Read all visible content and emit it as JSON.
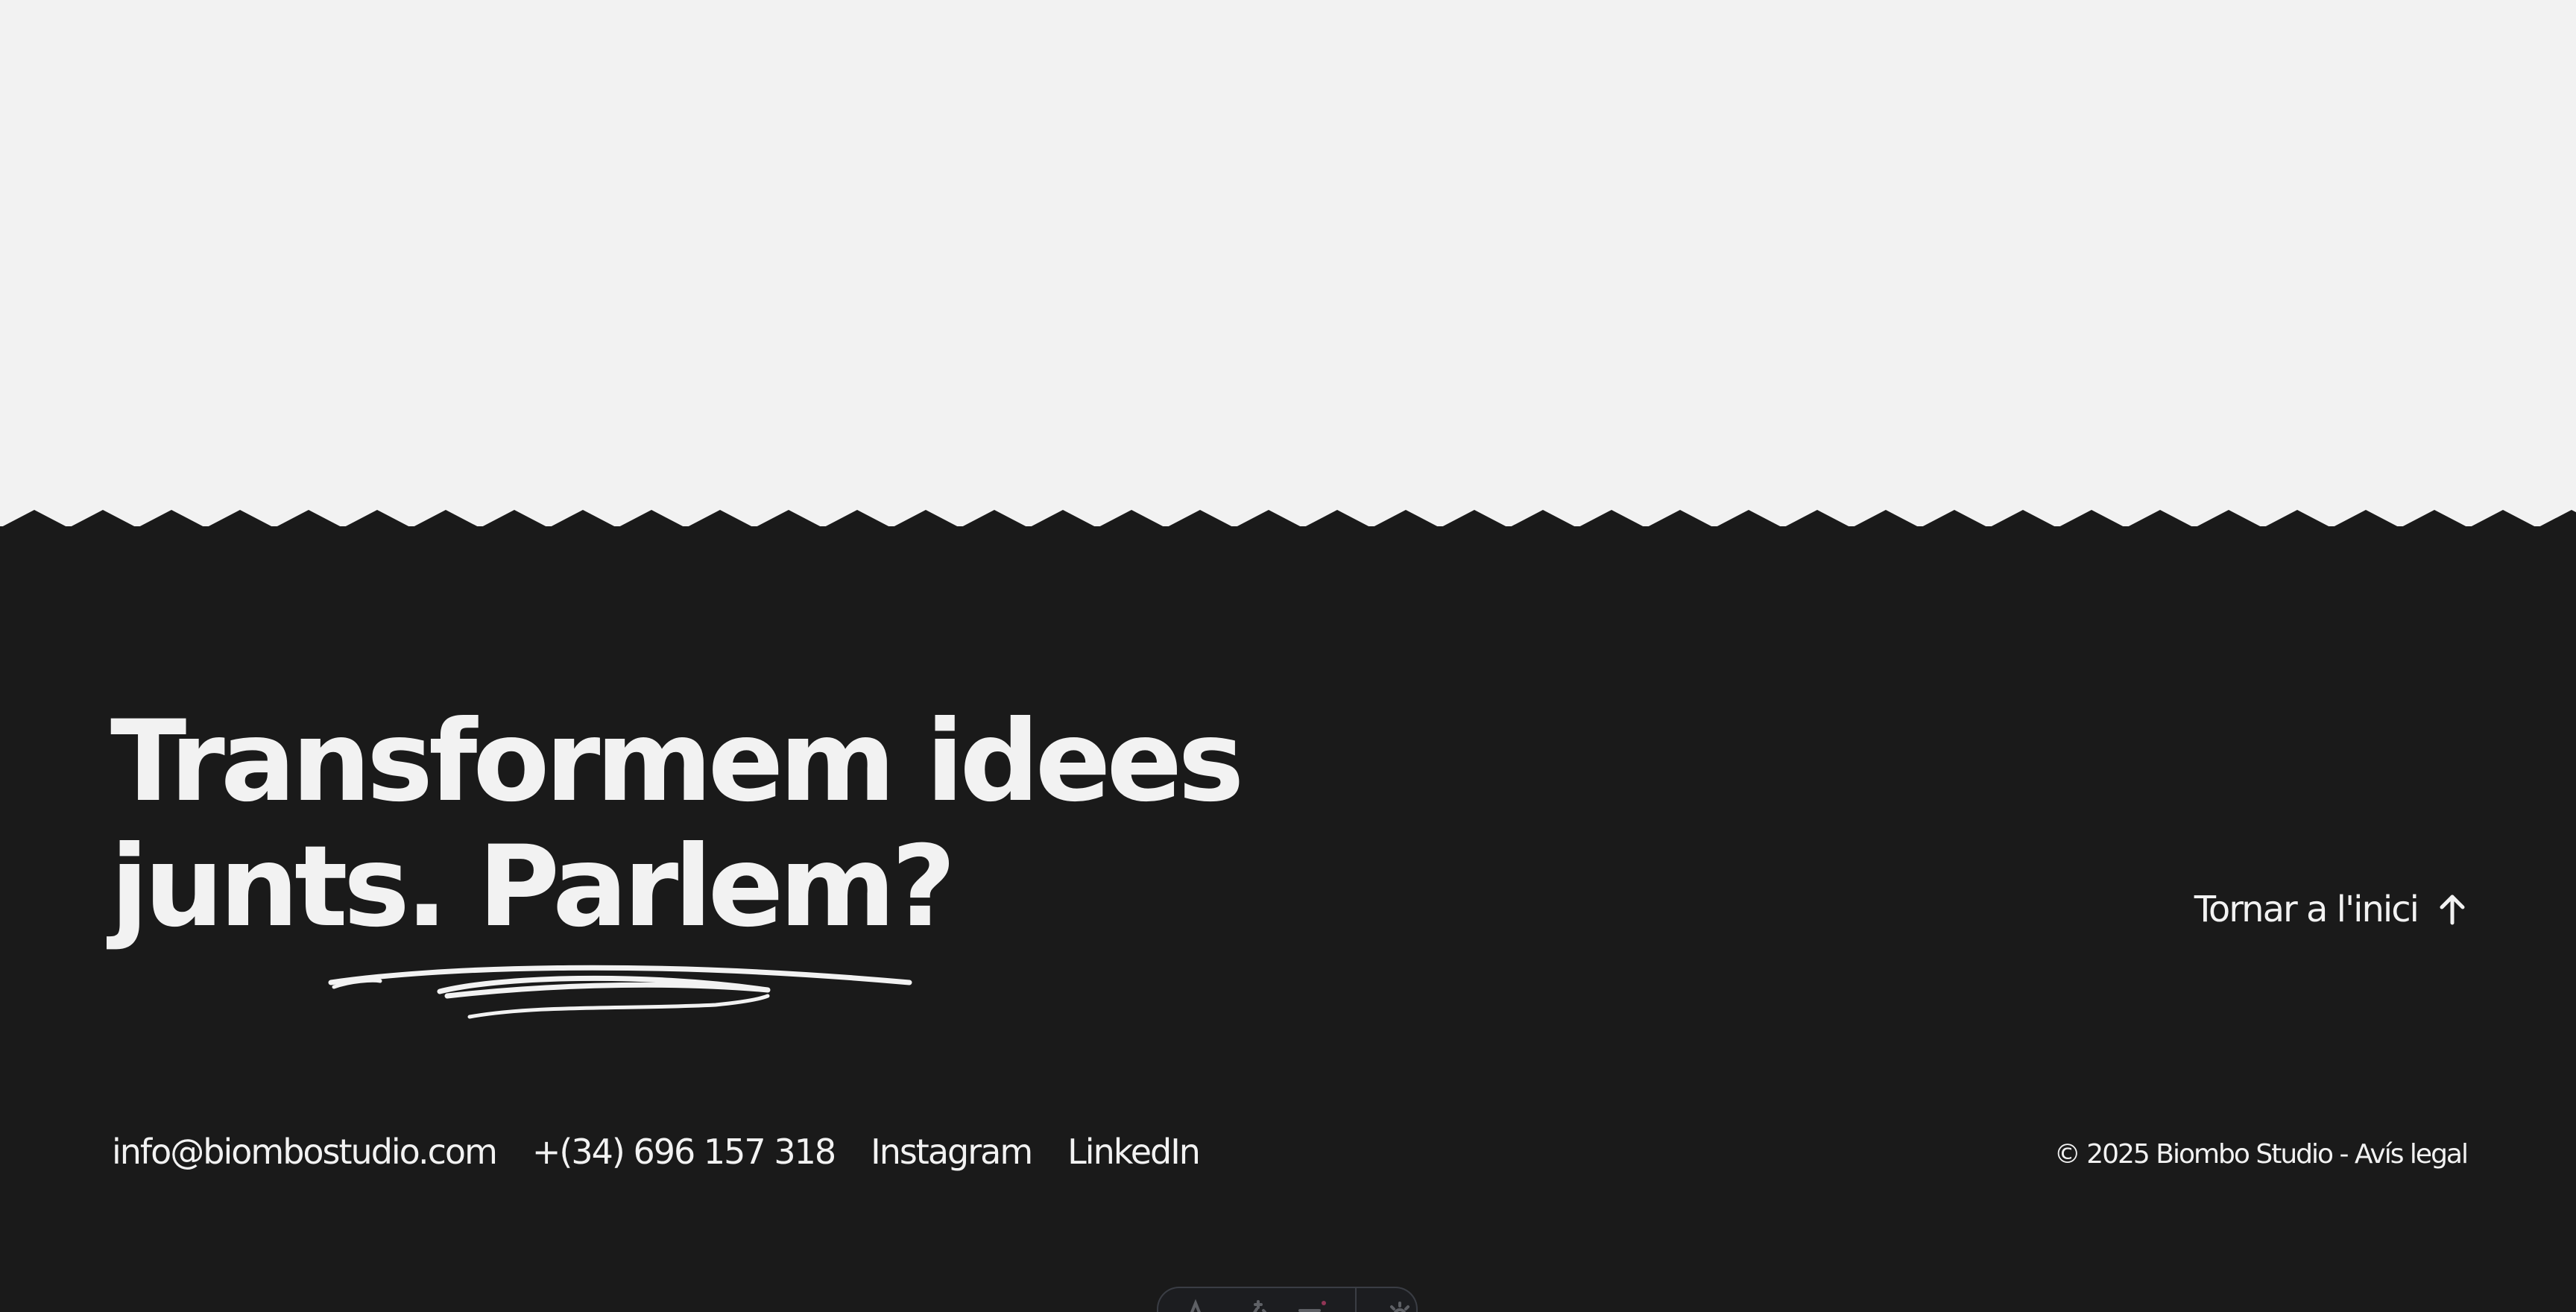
{
  "headline": {
    "line1": "Transformem idees",
    "line2_prefix": "junts. ",
    "line2_emphasis": "Parlem?"
  },
  "back_to_top": {
    "label": "Tornar a l'inici",
    "icon": "arrow-up-icon"
  },
  "contacts": [
    {
      "label": "info@biombostudio.com"
    },
    {
      "label": "+(34) 696 157 318"
    },
    {
      "label": "Instagram"
    },
    {
      "label": "LinkedIn"
    }
  ],
  "legal": {
    "copyright": "© 2025 Biombo Studio - ",
    "link": "Avís legal"
  },
  "toolbar": {
    "icons": [
      "text-tool-icon",
      "sparkle-tool-icon",
      "list-tool-icon",
      "settings-icon"
    ]
  },
  "colors": {
    "background_light": "#f2f2f2",
    "background_dark": "#1a1a1a",
    "text_light": "#f2f2f2",
    "toolbar_border": "#3a3d44",
    "toolbar_accent": "#e0457b"
  }
}
